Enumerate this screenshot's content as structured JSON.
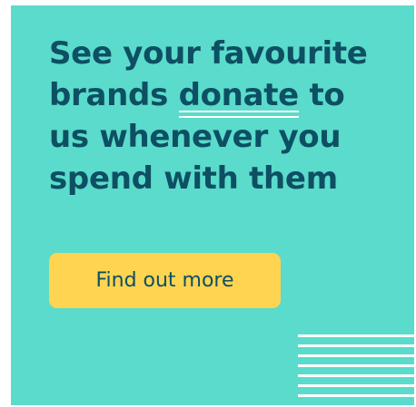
{
  "headline": {
    "line1": "See your favourite",
    "line2_before": "brands ",
    "line2_emphasis": "donate",
    "line2_after": " to",
    "line3": "us whenever you",
    "line4": "spend with them"
  },
  "cta": {
    "label": "Find out more"
  },
  "colors": {
    "background": "#5bdbcb",
    "text": "#0d4f63",
    "button": "#ffd451",
    "accent": "#ffffff"
  }
}
